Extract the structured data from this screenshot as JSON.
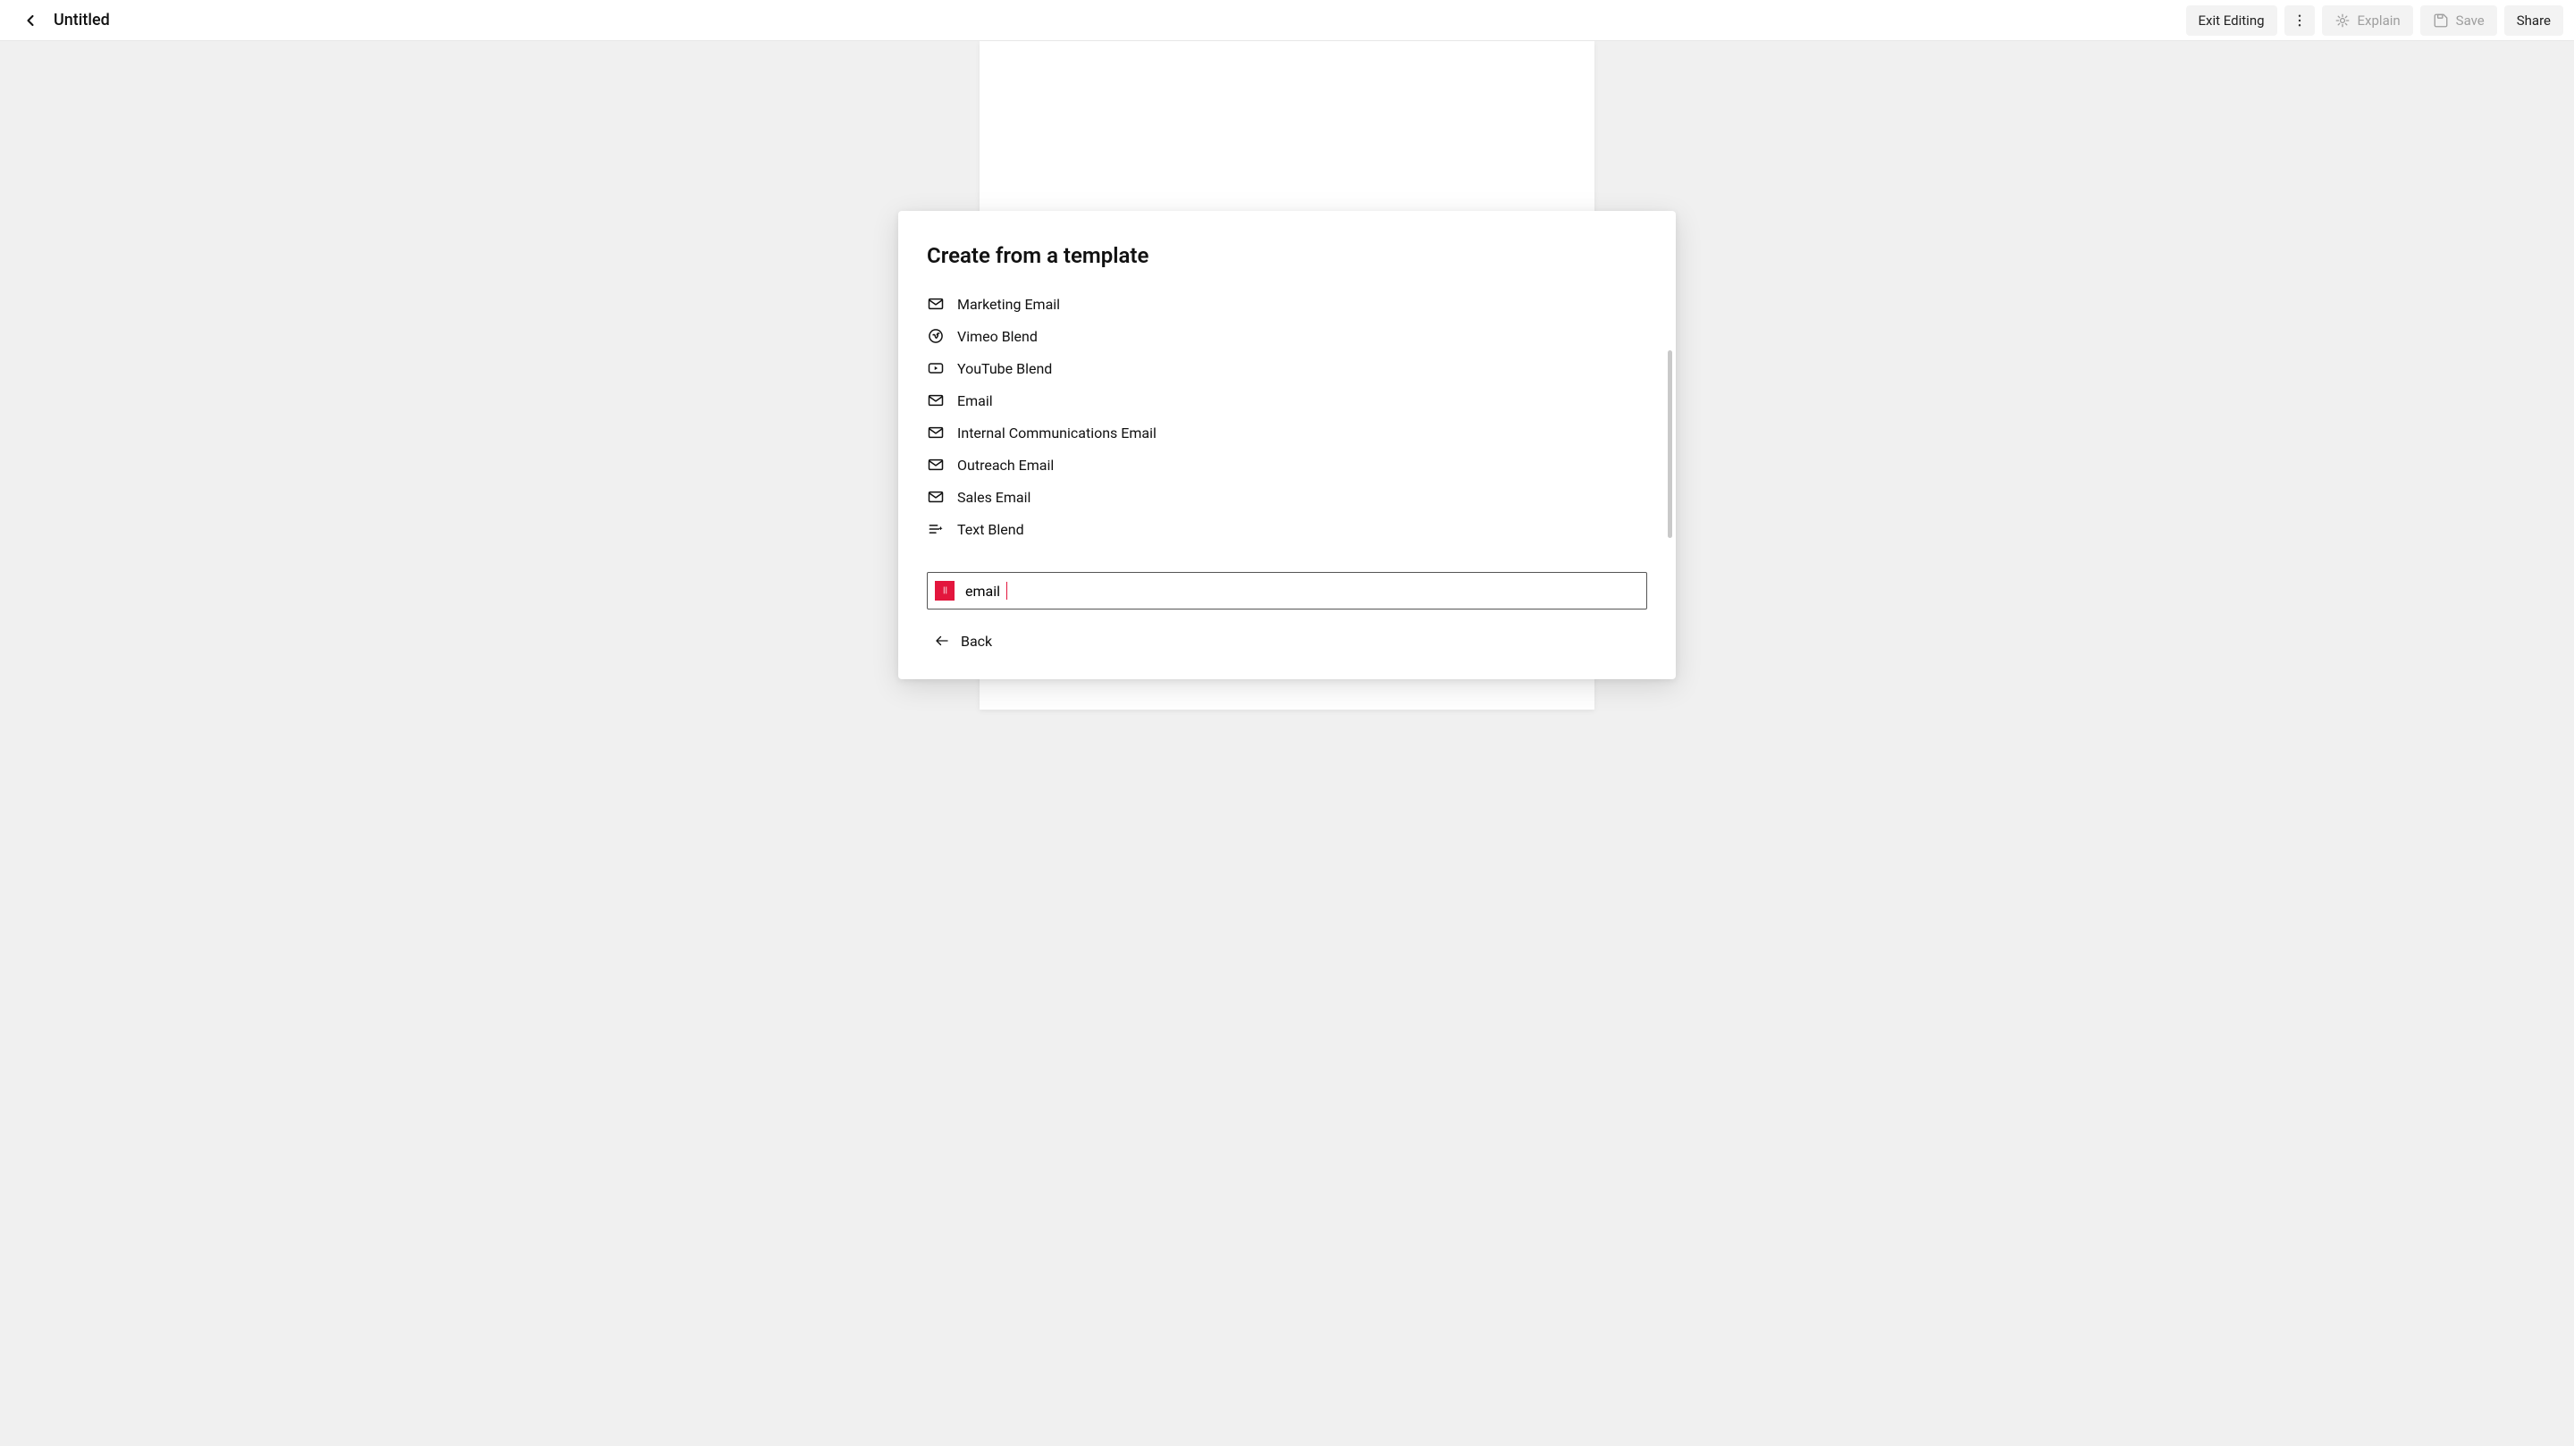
{
  "header": {
    "title": "Untitled",
    "exit_label": "Exit Editing",
    "explain_label": "Explain",
    "save_label": "Save",
    "share_label": "Share"
  },
  "modal": {
    "title": "Create from a template",
    "search_value": "email",
    "back_label": "Back",
    "templates": [
      {
        "icon": "mail",
        "label": "Marketing Email"
      },
      {
        "icon": "vimeo",
        "label": "Vimeo Blend"
      },
      {
        "icon": "youtube",
        "label": "YouTube Blend"
      },
      {
        "icon": "mail",
        "label": "Email"
      },
      {
        "icon": "mail",
        "label": "Internal Communications Email"
      },
      {
        "icon": "mail",
        "label": "Outreach Email"
      },
      {
        "icon": "mail",
        "label": "Sales Email"
      },
      {
        "icon": "textblend",
        "label": "Text Blend"
      }
    ]
  },
  "colors": {
    "accent_red": "#e3163d",
    "canvas_bg": "#f0f0f0",
    "page_bg": "#ffffff"
  }
}
